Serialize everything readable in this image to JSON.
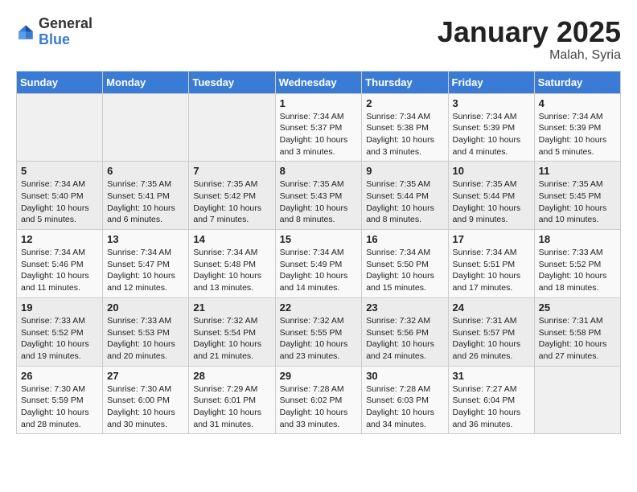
{
  "logo": {
    "general": "General",
    "blue": "Blue"
  },
  "title": "January 2025",
  "subtitle": "Malah, Syria",
  "header_days": [
    "Sunday",
    "Monday",
    "Tuesday",
    "Wednesday",
    "Thursday",
    "Friday",
    "Saturday"
  ],
  "weeks": [
    [
      {
        "day": "",
        "info": ""
      },
      {
        "day": "",
        "info": ""
      },
      {
        "day": "",
        "info": ""
      },
      {
        "day": "1",
        "info": "Sunrise: 7:34 AM\nSunset: 5:37 PM\nDaylight: 10 hours\nand 3 minutes."
      },
      {
        "day": "2",
        "info": "Sunrise: 7:34 AM\nSunset: 5:38 PM\nDaylight: 10 hours\nand 3 minutes."
      },
      {
        "day": "3",
        "info": "Sunrise: 7:34 AM\nSunset: 5:39 PM\nDaylight: 10 hours\nand 4 minutes."
      },
      {
        "day": "4",
        "info": "Sunrise: 7:34 AM\nSunset: 5:39 PM\nDaylight: 10 hours\nand 5 minutes."
      }
    ],
    [
      {
        "day": "5",
        "info": "Sunrise: 7:34 AM\nSunset: 5:40 PM\nDaylight: 10 hours\nand 5 minutes."
      },
      {
        "day": "6",
        "info": "Sunrise: 7:35 AM\nSunset: 5:41 PM\nDaylight: 10 hours\nand 6 minutes."
      },
      {
        "day": "7",
        "info": "Sunrise: 7:35 AM\nSunset: 5:42 PM\nDaylight: 10 hours\nand 7 minutes."
      },
      {
        "day": "8",
        "info": "Sunrise: 7:35 AM\nSunset: 5:43 PM\nDaylight: 10 hours\nand 8 minutes."
      },
      {
        "day": "9",
        "info": "Sunrise: 7:35 AM\nSunset: 5:44 PM\nDaylight: 10 hours\nand 8 minutes."
      },
      {
        "day": "10",
        "info": "Sunrise: 7:35 AM\nSunset: 5:44 PM\nDaylight: 10 hours\nand 9 minutes."
      },
      {
        "day": "11",
        "info": "Sunrise: 7:35 AM\nSunset: 5:45 PM\nDaylight: 10 hours\nand 10 minutes."
      }
    ],
    [
      {
        "day": "12",
        "info": "Sunrise: 7:34 AM\nSunset: 5:46 PM\nDaylight: 10 hours\nand 11 minutes."
      },
      {
        "day": "13",
        "info": "Sunrise: 7:34 AM\nSunset: 5:47 PM\nDaylight: 10 hours\nand 12 minutes."
      },
      {
        "day": "14",
        "info": "Sunrise: 7:34 AM\nSunset: 5:48 PM\nDaylight: 10 hours\nand 13 minutes."
      },
      {
        "day": "15",
        "info": "Sunrise: 7:34 AM\nSunset: 5:49 PM\nDaylight: 10 hours\nand 14 minutes."
      },
      {
        "day": "16",
        "info": "Sunrise: 7:34 AM\nSunset: 5:50 PM\nDaylight: 10 hours\nand 15 minutes."
      },
      {
        "day": "17",
        "info": "Sunrise: 7:34 AM\nSunset: 5:51 PM\nDaylight: 10 hours\nand 17 minutes."
      },
      {
        "day": "18",
        "info": "Sunrise: 7:33 AM\nSunset: 5:52 PM\nDaylight: 10 hours\nand 18 minutes."
      }
    ],
    [
      {
        "day": "19",
        "info": "Sunrise: 7:33 AM\nSunset: 5:52 PM\nDaylight: 10 hours\nand 19 minutes."
      },
      {
        "day": "20",
        "info": "Sunrise: 7:33 AM\nSunset: 5:53 PM\nDaylight: 10 hours\nand 20 minutes."
      },
      {
        "day": "21",
        "info": "Sunrise: 7:32 AM\nSunset: 5:54 PM\nDaylight: 10 hours\nand 21 minutes."
      },
      {
        "day": "22",
        "info": "Sunrise: 7:32 AM\nSunset: 5:55 PM\nDaylight: 10 hours\nand 23 minutes."
      },
      {
        "day": "23",
        "info": "Sunrise: 7:32 AM\nSunset: 5:56 PM\nDaylight: 10 hours\nand 24 minutes."
      },
      {
        "day": "24",
        "info": "Sunrise: 7:31 AM\nSunset: 5:57 PM\nDaylight: 10 hours\nand 26 minutes."
      },
      {
        "day": "25",
        "info": "Sunrise: 7:31 AM\nSunset: 5:58 PM\nDaylight: 10 hours\nand 27 minutes."
      }
    ],
    [
      {
        "day": "26",
        "info": "Sunrise: 7:30 AM\nSunset: 5:59 PM\nDaylight: 10 hours\nand 28 minutes."
      },
      {
        "day": "27",
        "info": "Sunrise: 7:30 AM\nSunset: 6:00 PM\nDaylight: 10 hours\nand 30 minutes."
      },
      {
        "day": "28",
        "info": "Sunrise: 7:29 AM\nSunset: 6:01 PM\nDaylight: 10 hours\nand 31 minutes."
      },
      {
        "day": "29",
        "info": "Sunrise: 7:28 AM\nSunset: 6:02 PM\nDaylight: 10 hours\nand 33 minutes."
      },
      {
        "day": "30",
        "info": "Sunrise: 7:28 AM\nSunset: 6:03 PM\nDaylight: 10 hours\nand 34 minutes."
      },
      {
        "day": "31",
        "info": "Sunrise: 7:27 AM\nSunset: 6:04 PM\nDaylight: 10 hours\nand 36 minutes."
      },
      {
        "day": "",
        "info": ""
      }
    ]
  ]
}
